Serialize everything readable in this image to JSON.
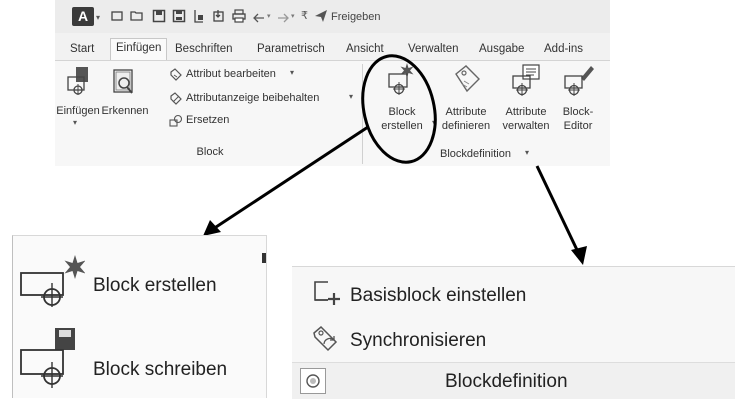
{
  "qat": {
    "app_letter": "A",
    "share_label": "Freigeben",
    "icons": [
      "app-menu-icon",
      "new-icon",
      "open-icon",
      "save-icon",
      "save-as-icon",
      "plot-icon",
      "export-icon",
      "print-icon",
      "undo-icon",
      "redo-icon",
      "customize-icon",
      "share-icon"
    ]
  },
  "tabs": [
    "Start",
    "Einfügen",
    "Beschriften",
    "Parametrisch",
    "Ansicht",
    "Verwalten",
    "Ausgabe",
    "Add-ins"
  ],
  "active_tab": "Einfügen",
  "ribbon": {
    "block_panel": {
      "title": "Block",
      "insert": "Einfügen",
      "recognize": "Erkennen",
      "edit_attribute": "Attribut bearbeiten",
      "keep_attribute_display": "Attributanzeige beibehalten",
      "replace": "Ersetzen"
    },
    "blockdef_panel": {
      "title": "Blockdefinition",
      "create_block_line1": "Block",
      "create_block_line2": "erstellen",
      "define_attributes_line1": "Attribute",
      "define_attributes_line2": "definieren",
      "manage_attributes_line1": "Attribute",
      "manage_attributes_line2": "verwalten",
      "block_editor_line1": "Block-",
      "block_editor_line2": "Editor"
    }
  },
  "zoom_left": {
    "create_block": "Block erstellen",
    "write_block": "Block schreiben"
  },
  "zoom_right": {
    "set_base_block": "Basisblock einstellen",
    "synchronize": "Synchronisieren",
    "panel_title": "Blockdefinition"
  },
  "colors": {
    "ribbon_bg": "#f2f2f2",
    "accent": "#222222"
  }
}
